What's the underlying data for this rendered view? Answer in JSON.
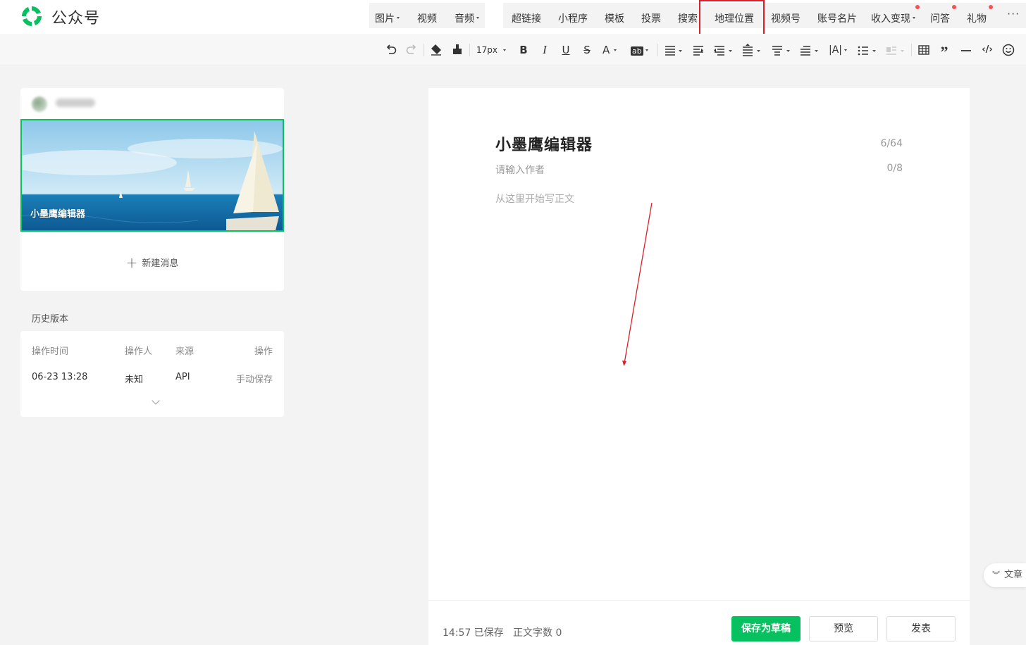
{
  "app": {
    "brand": "公众号",
    "brand_color": "#07c160"
  },
  "nav": {
    "group1": [
      {
        "label": "图片",
        "dropdown": true
      },
      {
        "label": "视频",
        "dropdown": false
      },
      {
        "label": "音频",
        "dropdown": true
      }
    ],
    "group2": [
      {
        "label": "超链接"
      },
      {
        "label": "小程序"
      },
      {
        "label": "模板"
      },
      {
        "label": "投票"
      },
      {
        "label": "搜索"
      },
      {
        "label": "地理位置",
        "highlighted": true
      },
      {
        "label": "视频号"
      },
      {
        "label": "账号名片"
      },
      {
        "label": "收入变现",
        "dropdown": true,
        "badge": true
      },
      {
        "label": "问答",
        "badge": true
      },
      {
        "label": "礼物",
        "badge": true
      }
    ],
    "more": "···"
  },
  "toolbar": {
    "font_size": "17px",
    "icons": [
      "undo-icon",
      "redo-icon",
      "clear-format-icon",
      "format-painter-icon",
      "font-size-select",
      "bold-icon",
      "italic-icon",
      "underline-icon",
      "strikethrough-icon",
      "font-color-icon",
      "background-color-icon",
      "align-icon",
      "indent-left-icon",
      "indent-right-icon",
      "line-height-icon",
      "paragraph-spacing-icon",
      "first-line-indent-icon",
      "letter-spacing-icon",
      "list-icon",
      "float-icon",
      "table-icon",
      "quote-icon",
      "divider-icon",
      "code-icon",
      "emoji-icon"
    ]
  },
  "message": {
    "cover_title": "小墨鹰编辑器",
    "new_message": "新建消息"
  },
  "history": {
    "title": "历史版本",
    "columns": [
      "操作时间",
      "操作人",
      "来源",
      "操作"
    ],
    "rows": [
      {
        "time": "06-23 13:28",
        "operator": "未知",
        "source": "API",
        "action": "手动保存"
      }
    ]
  },
  "editor": {
    "title": "小墨鹰编辑器",
    "title_count": "6/64",
    "author_placeholder": "请输入作者",
    "author_count": "0/8",
    "body_placeholder": "从这里开始写正文"
  },
  "footer": {
    "save_time": "14:57 已保存",
    "word_count": "正文字数 0",
    "save_draft": "保存为草稿",
    "preview": "预览",
    "publish": "发表"
  },
  "side_tab": {
    "label": "文章"
  }
}
